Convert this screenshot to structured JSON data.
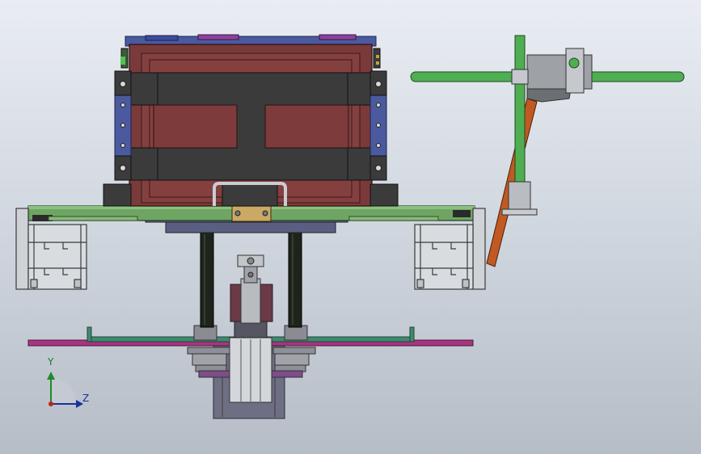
{
  "axes": {
    "y_label": "Y",
    "z_label": "Z"
  },
  "colors": {
    "background_top": "#e9edf3",
    "background_bottom": "#b6bdc7",
    "plate_green": "#6fa563",
    "housing_red": "#7a3a3a",
    "band_gray": "#3b3b3b",
    "bracket_blue": "#4b5a9e",
    "rod_green": "#4fae52",
    "rod_orange": "#c05a22",
    "disk_magenta": "#a8347f",
    "profile_gray": "#cfd3d8",
    "cylinder_gray": "#6e6f82"
  }
}
